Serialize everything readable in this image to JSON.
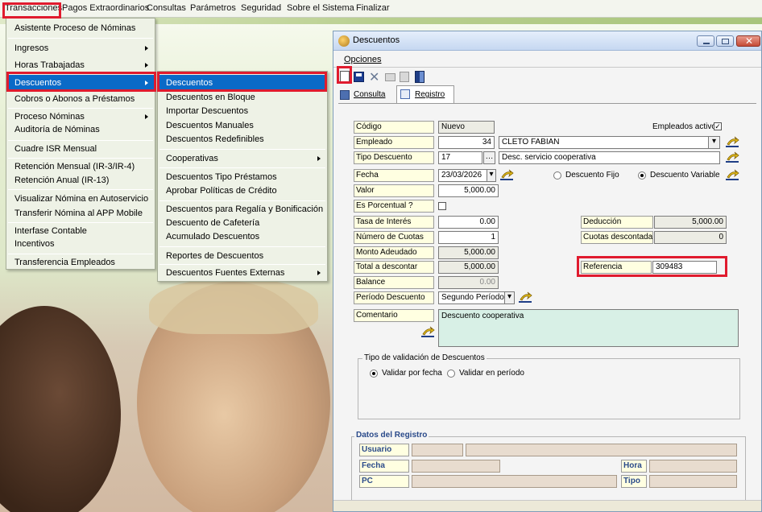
{
  "menubar": {
    "items": [
      "Transacciones",
      "Pagos Extraordinarios",
      "Consultas",
      "Parámetros",
      "Seguridad",
      "Sobre el Sistema",
      "Finalizar"
    ]
  },
  "transacciones_menu": {
    "items": [
      "Asistente Proceso de Nóminas",
      "Ingresos",
      "Horas Trabajadas",
      "Descuentos",
      "Cobros o Abonos a Préstamos",
      "Proceso Nóminas",
      "Auditoría de Nóminas",
      "Cuadre ISR Mensual",
      "Retención Mensual (IR-3/IR-4)",
      "Retención Anual (IR-13)",
      "Visualizar Nómina en Autoservicio",
      "Transferir Nómina al APP Mobile",
      "Interfase Contable",
      "Incentivos",
      "Transferencia Empleados"
    ]
  },
  "descuentos_menu": {
    "items": [
      "Descuentos",
      "Descuentos en Bloque",
      "Importar Descuentos",
      "Descuentos Manuales",
      "Descuentos Redefinibles",
      "Cooperativas",
      "Descuentos Tipo Préstamos",
      "Aprobar Políticas de Crédito",
      "Descuentos para Regalía y Bonificación",
      "Descuento de Cafetería",
      "Acumulado Descuentos",
      "Reportes de Descuentos",
      "Descuentos Fuentes Externas"
    ]
  },
  "window": {
    "title": "Descuentos",
    "menu_opciones": "Opciones",
    "tab_consulta": "Consulta",
    "tab_registro": "Registro"
  },
  "form": {
    "codigo_label": "Código",
    "codigo_value": "Nuevo",
    "empleados_activos": "Empleados activos",
    "empleado_label": "Empleado",
    "empleado_id": "34",
    "empleado_name": "CLETO FABIAN",
    "tipo_label": "Tipo Descuento",
    "tipo_id": "17",
    "tipo_desc": "Desc. servicio cooperativa",
    "fecha_label": "Fecha",
    "fecha_value": "23/03/2026",
    "radio_fijo": "Descuento Fijo",
    "radio_variable": "Descuento Variable",
    "valor_label": "Valor",
    "valor_value": "5,000.00",
    "porcentual_label": "Es Porcentual ?",
    "tasa_label": "Tasa de Interés",
    "tasa_value": "0.00",
    "deduccion_label": "Deducción",
    "deduccion_value": "5,000.00",
    "cuotas_label": "Número de Cuotas",
    "cuotas_value": "1",
    "cuotas_desc_label": "Cuotas descontadas",
    "cuotas_desc_value": "0",
    "monto_label": "Monto Adeudado",
    "monto_value": "5,000.00",
    "total_label": "Total a descontar",
    "total_value": "5,000.00",
    "referencia_label": "Referencia",
    "referencia_value": "309483",
    "balance_label": "Balance",
    "balance_value": "0.00",
    "periodo_label": "Período Descuento",
    "periodo_value": "Segundo Período",
    "comentario_label": "Comentario",
    "comentario_value": "Descuento cooperativa",
    "validacion_title": "Tipo de validación de Descuentos",
    "validar_fecha": "Validar por fecha",
    "validar_periodo": "Validar en período"
  },
  "registro": {
    "title": "Datos del Registro",
    "usuario": "Usuario",
    "fecha": "Fecha",
    "pc": "PC",
    "hora": "Hora",
    "tipo": "Tipo"
  },
  "colors": {
    "highlight": "#e01b2e",
    "menu_select": "#0a6ac7"
  }
}
